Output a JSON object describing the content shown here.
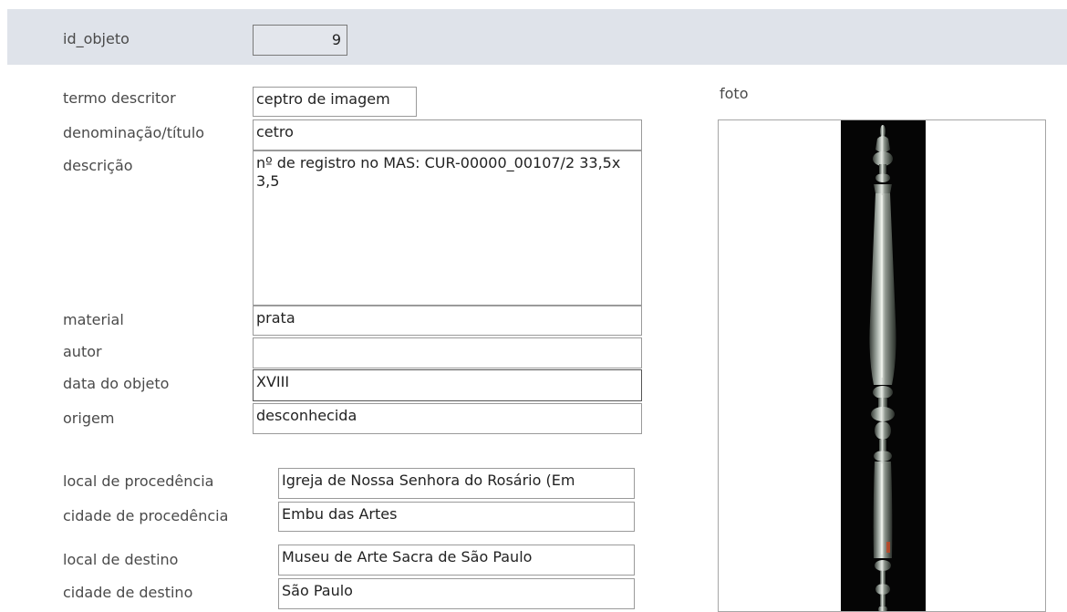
{
  "header": {
    "id_label": "id_objeto",
    "id_value": "9"
  },
  "fields": {
    "termo_descritor": {
      "label": "termo descritor",
      "value": "ceptro de imagem"
    },
    "denominacao": {
      "label": "denominação/título",
      "value": "cetro"
    },
    "descricao": {
      "label": "descrição",
      "value": "nº de registro no MAS: CUR-00000_00107/2 33,5x 3,5"
    },
    "material": {
      "label": "material",
      "value": "prata"
    },
    "autor": {
      "label": "autor",
      "value": ""
    },
    "data_objeto": {
      "label": "data do objeto",
      "value": "XVIII"
    },
    "origem": {
      "label": "origem",
      "value": "desconhecida"
    },
    "local_procedencia": {
      "label": "local de procedência",
      "value": "Igreja de Nossa Senhora do Rosário (Em"
    },
    "cidade_procedencia": {
      "label": "cidade de procedência",
      "value": "Embu das Artes"
    },
    "local_destino": {
      "label": "local de destino",
      "value": "Museu de Arte Sacra de São Paulo"
    },
    "cidade_destino": {
      "label": "cidade de destino",
      "value": "São Paulo"
    }
  },
  "photo": {
    "label": "foto"
  }
}
